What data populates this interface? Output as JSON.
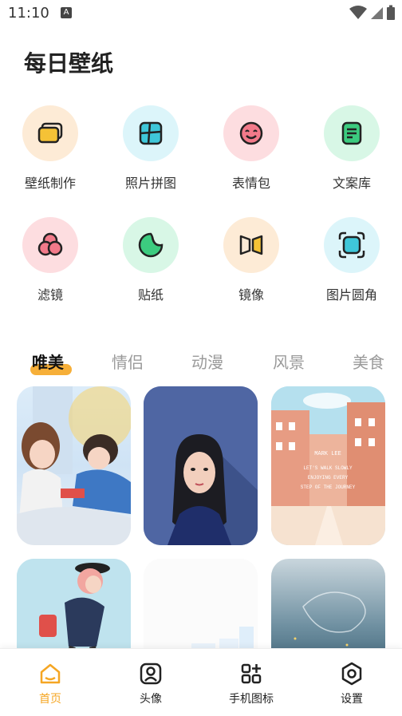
{
  "status": {
    "time": "11:10",
    "badge": "A"
  },
  "title": "每日壁纸",
  "tools": [
    {
      "label": "壁纸制作",
      "icon": "wallpaper-make-icon",
      "bg": "#FDEBD6",
      "accent": "#F5C236"
    },
    {
      "label": "照片拼图",
      "icon": "collage-icon",
      "bg": "#DCF5FA",
      "accent": "#3FC7D9"
    },
    {
      "label": "表情包",
      "icon": "emoji-icon",
      "bg": "#FDDDE0",
      "accent": "#F27A8A"
    },
    {
      "label": "文案库",
      "icon": "text-library-icon",
      "bg": "#D8F7E6",
      "accent": "#3CCB7F"
    },
    {
      "label": "滤镜",
      "icon": "filter-icon",
      "bg": "#FDDDE0",
      "accent": "#F27A8A"
    },
    {
      "label": "贴纸",
      "icon": "sticker-icon",
      "bg": "#D8F7E6",
      "accent": "#3CCB7F"
    },
    {
      "label": "镜像",
      "icon": "mirror-icon",
      "bg": "#FDEBD6",
      "accent": "#F5C236"
    },
    {
      "label": "图片圆角",
      "icon": "rounded-corner-icon",
      "bg": "#DCF5FA",
      "accent": "#3FC7D9"
    }
  ],
  "tabs": [
    "唯美",
    "情侣",
    "动漫",
    "风景",
    "美食"
  ],
  "active_tab": "唯美",
  "wallpaper_text": [
    "MARK LEE",
    "LET'S WALK SLOWLY",
    "ENJOYING EVERY",
    "STEP OF THE JOURNEY"
  ],
  "nav": [
    {
      "label": "首页",
      "icon": "home-icon",
      "active": true
    },
    {
      "label": "头像",
      "icon": "avatar-icon",
      "active": false
    },
    {
      "label": "手机图标",
      "icon": "app-icons-icon",
      "active": false
    },
    {
      "label": "设置",
      "icon": "settings-icon",
      "active": false
    }
  ],
  "colors": {
    "accent": "#F5A623"
  }
}
